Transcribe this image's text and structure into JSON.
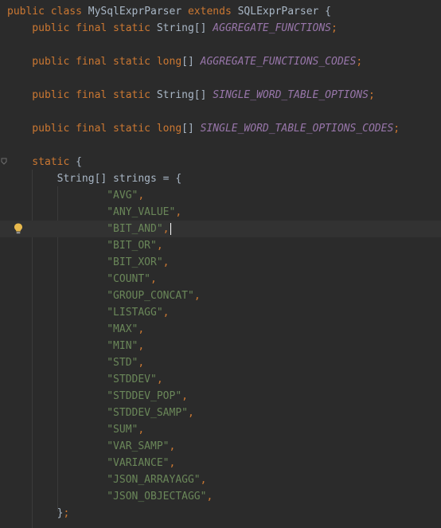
{
  "editor": {
    "language": "java",
    "lines": [
      {
        "tokens": [
          {
            "t": "public class ",
            "c": "kw"
          },
          {
            "t": "MySqlExprParser ",
            "c": "cls"
          },
          {
            "t": "extends ",
            "c": "kw"
          },
          {
            "t": "SQLExprParser {",
            "c": "plain"
          }
        ]
      },
      {
        "tokens": [
          {
            "t": "    public final static ",
            "c": "kw"
          },
          {
            "t": "String[] ",
            "c": "plain"
          },
          {
            "t": "AGGREGATE_FUNCTIONS",
            "c": "fld"
          },
          {
            "t": ";",
            "c": "pun"
          }
        ]
      },
      {
        "tokens": []
      },
      {
        "tokens": [
          {
            "t": "    public final static long",
            "c": "kw"
          },
          {
            "t": "[] ",
            "c": "plain"
          },
          {
            "t": "AGGREGATE_FUNCTIONS_CODES",
            "c": "fld"
          },
          {
            "t": ";",
            "c": "pun"
          }
        ]
      },
      {
        "tokens": []
      },
      {
        "tokens": [
          {
            "t": "    public final static ",
            "c": "kw"
          },
          {
            "t": "String[] ",
            "c": "plain"
          },
          {
            "t": "SINGLE_WORD_TABLE_OPTIONS",
            "c": "fld"
          },
          {
            "t": ";",
            "c": "pun"
          }
        ]
      },
      {
        "tokens": []
      },
      {
        "tokens": [
          {
            "t": "    public final static long",
            "c": "kw"
          },
          {
            "t": "[] ",
            "c": "plain"
          },
          {
            "t": "SINGLE_WORD_TABLE_OPTIONS_CODES",
            "c": "fld"
          },
          {
            "t": ";",
            "c": "pun"
          }
        ]
      },
      {
        "tokens": []
      },
      {
        "tokens": [
          {
            "t": "    static ",
            "c": "kw"
          },
          {
            "t": "{",
            "c": "plain"
          }
        ]
      },
      {
        "tokens": [
          {
            "t": "        String[] strings = {",
            "c": "plain"
          }
        ]
      },
      {
        "tokens": [
          {
            "t": "                \"AVG\"",
            "c": "str"
          },
          {
            "t": ",",
            "c": "pun"
          }
        ]
      },
      {
        "tokens": [
          {
            "t": "                \"ANY_VALUE\"",
            "c": "str"
          },
          {
            "t": ",",
            "c": "pun"
          }
        ]
      },
      {
        "tokens": [
          {
            "t": "                \"BIT_AND\"",
            "c": "str"
          },
          {
            "t": ",",
            "c": "pun"
          }
        ],
        "current": true,
        "caret": true,
        "bulb": true
      },
      {
        "tokens": [
          {
            "t": "                \"BIT_OR\"",
            "c": "str"
          },
          {
            "t": ",",
            "c": "pun"
          }
        ]
      },
      {
        "tokens": [
          {
            "t": "                \"BIT_XOR\"",
            "c": "str"
          },
          {
            "t": ",",
            "c": "pun"
          }
        ]
      },
      {
        "tokens": [
          {
            "t": "                \"COUNT\"",
            "c": "str"
          },
          {
            "t": ",",
            "c": "pun"
          }
        ]
      },
      {
        "tokens": [
          {
            "t": "                \"GROUP_CONCAT\"",
            "c": "str"
          },
          {
            "t": ",",
            "c": "pun"
          }
        ]
      },
      {
        "tokens": [
          {
            "t": "                \"LISTAGG\"",
            "c": "str"
          },
          {
            "t": ",",
            "c": "pun"
          }
        ]
      },
      {
        "tokens": [
          {
            "t": "                \"MAX\"",
            "c": "str"
          },
          {
            "t": ",",
            "c": "pun"
          }
        ]
      },
      {
        "tokens": [
          {
            "t": "                \"MIN\"",
            "c": "str"
          },
          {
            "t": ",",
            "c": "pun"
          }
        ]
      },
      {
        "tokens": [
          {
            "t": "                \"STD\"",
            "c": "str"
          },
          {
            "t": ",",
            "c": "pun"
          }
        ]
      },
      {
        "tokens": [
          {
            "t": "                \"STDDEV\"",
            "c": "str"
          },
          {
            "t": ",",
            "c": "pun"
          }
        ]
      },
      {
        "tokens": [
          {
            "t": "                \"STDDEV_POP\"",
            "c": "str"
          },
          {
            "t": ",",
            "c": "pun"
          }
        ]
      },
      {
        "tokens": [
          {
            "t": "                \"STDDEV_SAMP\"",
            "c": "str"
          },
          {
            "t": ",",
            "c": "pun"
          }
        ]
      },
      {
        "tokens": [
          {
            "t": "                \"SUM\"",
            "c": "str"
          },
          {
            "t": ",",
            "c": "pun"
          }
        ]
      },
      {
        "tokens": [
          {
            "t": "                \"VAR_SAMP\"",
            "c": "str"
          },
          {
            "t": ",",
            "c": "pun"
          }
        ]
      },
      {
        "tokens": [
          {
            "t": "                \"VARIANCE\"",
            "c": "str"
          },
          {
            "t": ",",
            "c": "pun"
          }
        ]
      },
      {
        "tokens": [
          {
            "t": "                \"JSON_ARRAYAGG\"",
            "c": "str"
          },
          {
            "t": ",",
            "c": "pun"
          }
        ]
      },
      {
        "tokens": [
          {
            "t": "                \"JSON_OBJECTAGG\"",
            "c": "str"
          },
          {
            "t": ",",
            "c": "pun"
          }
        ]
      },
      {
        "tokens": [
          {
            "t": "        }",
            "c": "plain"
          },
          {
            "t": ";",
            "c": "pun"
          }
        ]
      }
    ],
    "icons": {
      "intention_bulb": "lightbulb-icon",
      "fold_marker": "fold-icon"
    },
    "colors": {
      "background": "#2b2b2b",
      "keyword": "#cc7832",
      "string": "#6a8759",
      "field": "#9876aa",
      "text": "#a9b7c6",
      "bulb": "#e8b94d"
    }
  }
}
